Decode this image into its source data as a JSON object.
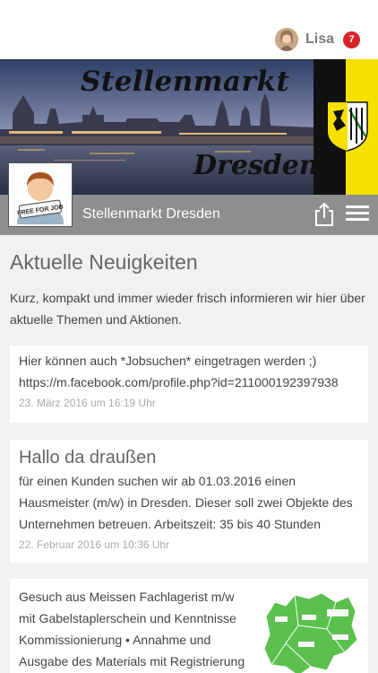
{
  "header": {
    "username": "Lisa",
    "notification_count": "7"
  },
  "banner": {
    "line1": "Stellenmarkt",
    "line2": "Dresden",
    "badge_text": "FREE FOR JOB"
  },
  "page": {
    "name": "Stellenmarkt Dresden"
  },
  "news": {
    "title": "Aktuelle Neuigkeiten",
    "description": "Kurz, kompakt und immer wieder frisch informieren wir hier über aktuelle Themen und Aktionen.",
    "posts": [
      {
        "text_line1": "Hier können auch *Jobsuchen* eingetragen werden ;)",
        "text_line2": "https://m.facebook.com/profile.php?id=211000192397938",
        "date": "23. März 2016 um 16:19 Uhr"
      },
      {
        "title": "Hallo da draußen",
        "text": "für einen Kunden suchen wir ab 01.03.2016 einen Hausmeister (m/w) in Dresden. Dieser soll zwei Objekte des Unternehmen betreuen. Arbeitszeit: 35 bis 40 Stunden",
        "date": "22. Februar 2016 um 10:36 Uhr"
      },
      {
        "text": "Gesuch aus Meissen Fachlagerist m/w mit Gabelstaplerschein und Kenntnisse Kommissionierung • Annahme und Ausgabe des Materials mit Registrierung"
      }
    ]
  },
  "colors": {
    "profile_strip": "#8e8e8e",
    "badge": "#d9222a",
    "background": "#f1f1f1"
  },
  "icons": [
    "share-icon",
    "hamburger-menu-icon",
    "saxony-coat-of-arms-icon"
  ]
}
